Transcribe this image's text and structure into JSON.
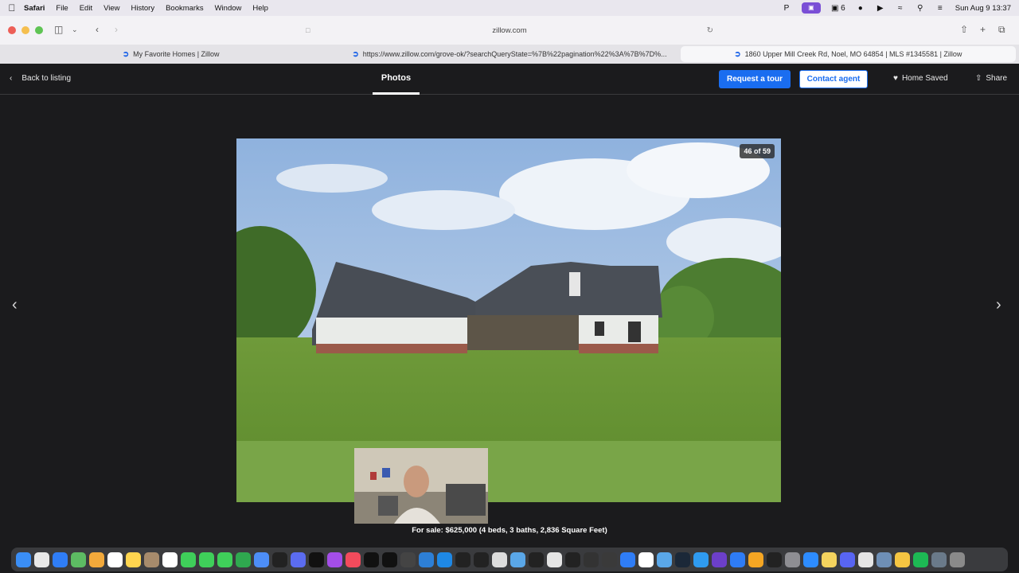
{
  "menubar": {
    "app_name": "Safari",
    "items": [
      "File",
      "Edit",
      "View",
      "History",
      "Bookmarks",
      "Window",
      "Help"
    ],
    "status_badge": "6",
    "date_time": "Sun Aug 9  13:37"
  },
  "browser": {
    "url": "zillow.com",
    "tabs": [
      {
        "label": "My Favorite Homes | Zillow",
        "active": false
      },
      {
        "label": "https://www.zillow.com/grove-ok/?searchQueryState=%7B%22pagination%22%3A%7B%7D%...",
        "active": false
      },
      {
        "label": "1860 Upper Mill Creek Rd, Noel, MO 64854 | MLS #1345581 | Zillow",
        "active": true
      }
    ]
  },
  "header": {
    "back_label": "Back to listing",
    "title": "Photos",
    "tour_button": "Request a tour",
    "contact_button": "Contact agent",
    "saved_label": "Home Saved",
    "share_label": "Share"
  },
  "photo": {
    "counter": "46 of 59",
    "caption": "For sale: $625,000 (4 beds, 3 baths, 2,836 Square Feet)"
  },
  "colors": {
    "accent": "#1a6df0",
    "background": "#1b1b1d"
  },
  "dock": {
    "icons": [
      "finder-icon",
      "launchpad-icon",
      "safari-icon",
      "maps-icon",
      "photos-icon",
      "calendar-icon",
      "notes-icon",
      "contacts-icon",
      "reminders-icon",
      "facetime-icon",
      "messages-icon",
      "phone-icon",
      "numbers-icon",
      "mail-icon",
      "stocks-icon",
      "arc-icon",
      "tv-icon",
      "podcasts-icon",
      "music-icon",
      "tiktok-icon",
      "chatgpt-icon",
      "proxyman-icon",
      "vscode-icon",
      "xcode-icon",
      "cursor-icon",
      "perplexity-icon",
      "files-icon",
      "folder-icon",
      "openai-icon",
      "preview-icon",
      "terminal-icon",
      "screen-icon",
      "sim-icon",
      "spark-icon",
      "notion-icon",
      "testflight-icon",
      "steam-icon",
      "appstore-icon",
      "obsidian-icon",
      "keynote-icon",
      "pages-icon",
      "epic-icon",
      "settings-icon",
      "zoom-icon",
      "notes-app-icon",
      "discord-icon",
      "calendar-app-icon",
      "finder-2-icon",
      "pixel-icon",
      "spotify-icon",
      "downloads-icon",
      "trash-icon"
    ]
  }
}
